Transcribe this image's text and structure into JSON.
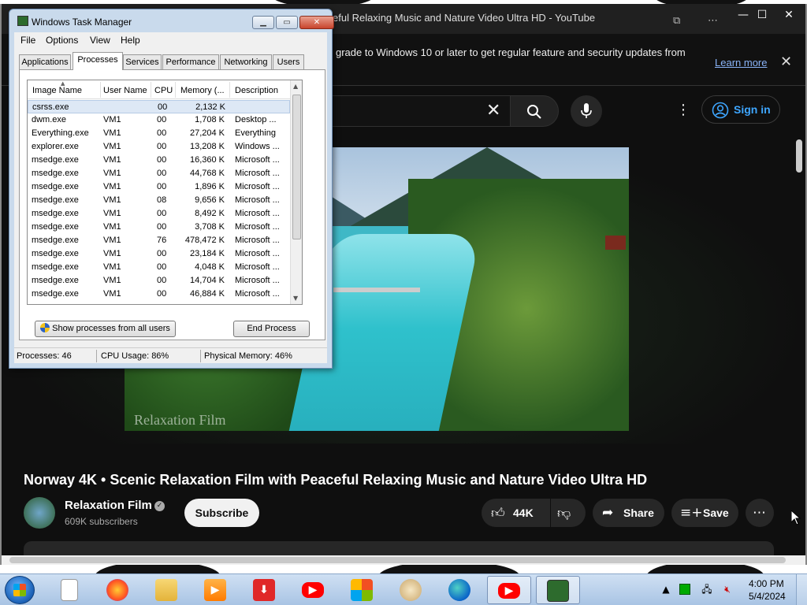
{
  "browser": {
    "tab_title": "eful Relaxing Music and Nature Video Ultra HD - YouTube",
    "minimize": "—",
    "maximize": "☐",
    "close": "✕",
    "infobar_text": "grade to Windows 10 or later to get regular feature and security updates from",
    "learn_more": "Learn more",
    "infobar_close": "✕"
  },
  "youtube": {
    "sign_in": "Sign in",
    "video_title": "Norway 4K • Scenic Relaxation Film with Peaceful Relaxing Music and Nature Video Ultra HD",
    "channel_name": "Relaxation Film",
    "subscribers": "609K subscribers",
    "subscribe": "Subscribe",
    "likes": "44K",
    "share": "Share",
    "save": "Save",
    "watermark": "Relaxation Film"
  },
  "taskmanager": {
    "title": "Windows Task Manager",
    "menus": [
      "File",
      "Options",
      "View",
      "Help"
    ],
    "tabs": [
      "Applications",
      "Processes",
      "Services",
      "Performance",
      "Networking",
      "Users"
    ],
    "active_tab": "Processes",
    "columns": [
      "Image Name",
      "User Name",
      "CPU",
      "Memory (...",
      "Description"
    ],
    "rows": [
      {
        "name": "csrss.exe",
        "user": "",
        "cpu": "00",
        "mem": "2,132 K",
        "desc": ""
      },
      {
        "name": "dwm.exe",
        "user": "VM1",
        "cpu": "00",
        "mem": "1,708 K",
        "desc": "Desktop ..."
      },
      {
        "name": "Everything.exe",
        "user": "VM1",
        "cpu": "00",
        "mem": "27,204 K",
        "desc": "Everything"
      },
      {
        "name": "explorer.exe",
        "user": "VM1",
        "cpu": "00",
        "mem": "13,208 K",
        "desc": "Windows ..."
      },
      {
        "name": "msedge.exe",
        "user": "VM1",
        "cpu": "00",
        "mem": "16,360 K",
        "desc": "Microsoft ..."
      },
      {
        "name": "msedge.exe",
        "user": "VM1",
        "cpu": "00",
        "mem": "44,768 K",
        "desc": "Microsoft ..."
      },
      {
        "name": "msedge.exe",
        "user": "VM1",
        "cpu": "00",
        "mem": "1,896 K",
        "desc": "Microsoft ..."
      },
      {
        "name": "msedge.exe",
        "user": "VM1",
        "cpu": "08",
        "mem": "9,656 K",
        "desc": "Microsoft ..."
      },
      {
        "name": "msedge.exe",
        "user": "VM1",
        "cpu": "00",
        "mem": "8,492 K",
        "desc": "Microsoft ..."
      },
      {
        "name": "msedge.exe",
        "user": "VM1",
        "cpu": "00",
        "mem": "3,708 K",
        "desc": "Microsoft ..."
      },
      {
        "name": "msedge.exe",
        "user": "VM1",
        "cpu": "76",
        "mem": "478,472 K",
        "desc": "Microsoft ..."
      },
      {
        "name": "msedge.exe",
        "user": "VM1",
        "cpu": "00",
        "mem": "23,184 K",
        "desc": "Microsoft ..."
      },
      {
        "name": "msedge.exe",
        "user": "VM1",
        "cpu": "00",
        "mem": "4,048 K",
        "desc": "Microsoft ..."
      },
      {
        "name": "msedge.exe",
        "user": "VM1",
        "cpu": "00",
        "mem": "14,704 K",
        "desc": "Microsoft ..."
      },
      {
        "name": "msedge.exe",
        "user": "VM1",
        "cpu": "00",
        "mem": "46,884 K",
        "desc": "Microsoft ..."
      }
    ],
    "selected_row": 0,
    "show_all_button": "Show processes from all users",
    "end_process_button": "End Process",
    "status": {
      "processes": "Processes: 46",
      "cpu": "CPU Usage: 86%",
      "memory": "Physical Memory: 46%"
    }
  },
  "taskbar": {
    "apps": [
      "file-icon",
      "firefox-icon",
      "folder-icon",
      "media-player-icon",
      "download-icon",
      "youtube-icon",
      "store-icon",
      "paint-icon",
      "edge-icon",
      "youtube-icon",
      "task-manager-icon"
    ],
    "active_apps": [
      9,
      10
    ],
    "time": "4:00 PM",
    "date": "5/4/2024"
  },
  "colors": {
    "yt_background": "#0f0f0f",
    "link_blue": "#3ea6ff",
    "taskbar": "#b9d1ea"
  }
}
